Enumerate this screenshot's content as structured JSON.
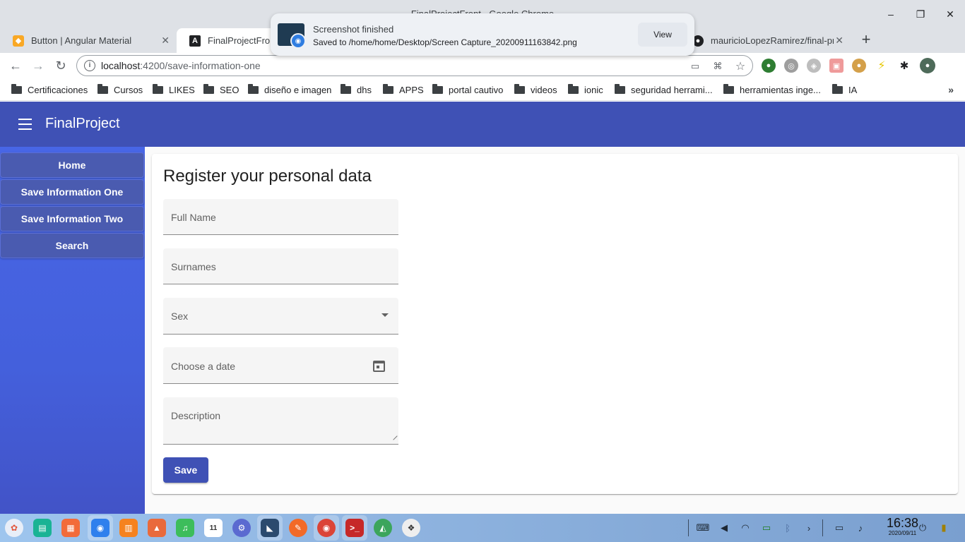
{
  "window": {
    "title": "FinalProjectFront - Google Chrome",
    "controls": {
      "minimize": "–",
      "maximize": "❐",
      "close": "✕"
    }
  },
  "tabs": [
    {
      "label": "Button | Angular Material",
      "icon": "angular-material-icon",
      "close": "✕"
    },
    {
      "label": "FinalProjectFront",
      "icon": "angular-icon",
      "close": "✕"
    },
    {
      "label": "mauricioLopezRamirez/final-pr",
      "icon": "github-icon",
      "close": "✕"
    }
  ],
  "new_tab": "+",
  "notification": {
    "title": "Screenshot finished",
    "subtitle": "Saved to /home/home/Desktop/Screen Capture_20200911163842.png",
    "view_label": "View"
  },
  "toolbar": {
    "url_host": "localhost",
    "url_path": ":4200/save-information-one",
    "info_icon_text": "i"
  },
  "bookmarks": [
    "Certificaciones",
    "Cursos",
    "LIKES",
    "SEO",
    "diseño e imagen",
    "dhs",
    "APPS",
    "portal cautivo",
    "videos",
    "ionic",
    "seguridad herrami...",
    "herramientas inge...",
    "IA"
  ],
  "bookmarks_more": "»",
  "app": {
    "title": "FinalProject",
    "nav": [
      "Home",
      "Save Information One",
      "Save Information Two",
      "Search"
    ],
    "form": {
      "title": "Register your personal data",
      "full_name": "Full Name",
      "surnames": "Surnames",
      "sex": "Sex",
      "date": "Choose a date",
      "description": "Description",
      "save": "Save"
    }
  },
  "taskbar": {
    "time": "16:38",
    "date": "2020/09/11",
    "calendar_day": "11"
  },
  "colors": {
    "primary": "#3f51b5",
    "sidenav": "#4866e6",
    "field_bg": "#f5f5f5"
  }
}
